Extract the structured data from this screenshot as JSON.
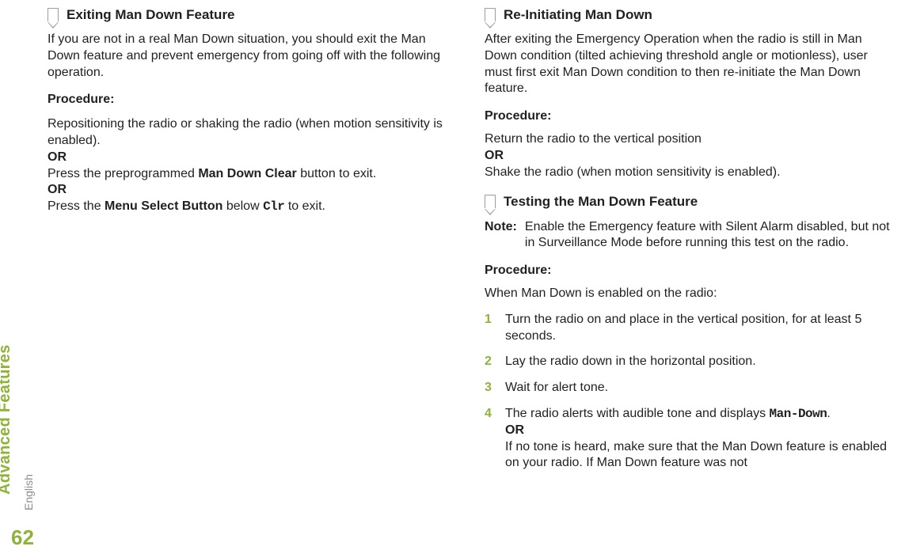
{
  "side": {
    "section_label": "Advanced Features",
    "language": "English",
    "page_number": "62"
  },
  "left": {
    "heading": "Exiting Man Down Feature",
    "intro": "If you are not in a real Man Down situation, you should exit the Man Down feature and prevent emergency from going off with the following operation.",
    "proc_label": "Procedure:",
    "step_a": "Repositioning the radio or shaking the radio (when motion sensitivity is enabled).",
    "or": "OR",
    "step_b_pre": "Press the preprogrammed ",
    "step_b_btn": "Man Down Clear",
    "step_b_post": " button to exit.",
    "step_c_pre": "Press the ",
    "step_c_btn": "Menu Select Button",
    "step_c_mid": " below ",
    "step_c_disp": "Clr",
    "step_c_post": " to exit."
  },
  "right": {
    "sec1": {
      "heading": "Re-Initiating Man Down",
      "intro": "After exiting the Emergency Operation when the radio is still in Man Down condition (tilted achieving threshold angle or motionless), user must first exit Man Down condition to then re-initiate the Man Down feature.",
      "proc_label": "Procedure:",
      "line1": "Return the radio to the vertical position",
      "or": "OR",
      "line2": "Shake the radio (when motion sensitivity is enabled)."
    },
    "sec2": {
      "heading": "Testing the Man Down Feature",
      "note_key": "Note:",
      "note_body": "Enable the Emergency feature with Silent Alarm disabled, but not in Surveillance Mode before running this test on the radio.",
      "proc_label": "Procedure:",
      "when_line": "When Man Down is enabled on the radio:",
      "steps": [
        "Turn the radio on and place in the vertical position, for at least 5 seconds.",
        "Lay the radio down in the horizontal position.",
        "Wait for alert tone."
      ],
      "step4": {
        "pre": "The radio alerts with audible tone and displays ",
        "disp": "Man-Down",
        "post": ".",
        "or": "OR",
        "tail": "If no tone is heard, make sure that the Man Down feature is enabled on your radio. If Man Down feature was not"
      },
      "nums": {
        "n1": "1",
        "n2": "2",
        "n3": "3",
        "n4": "4"
      }
    }
  }
}
